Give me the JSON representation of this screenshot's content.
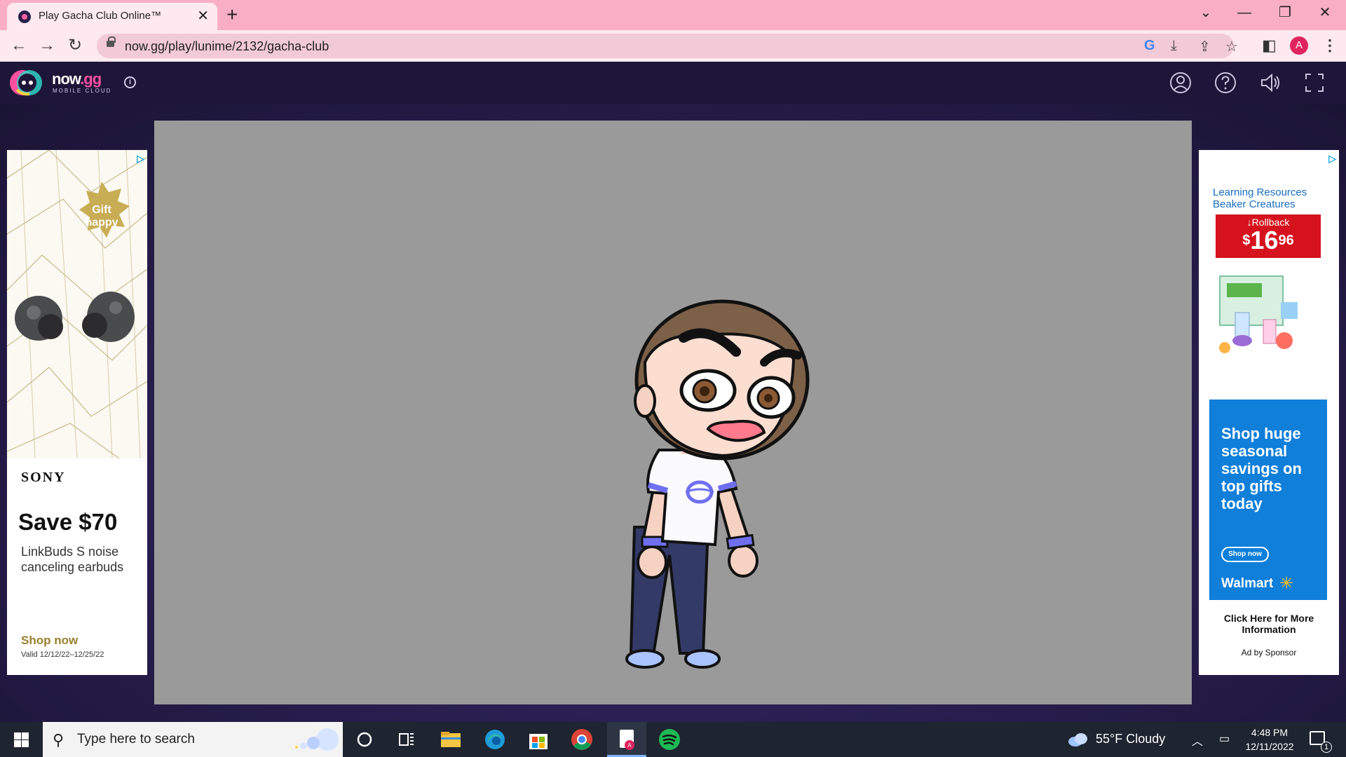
{
  "browser": {
    "tab_title": "Play Gacha Club Online™",
    "tab_close": "✕",
    "new_tab": "+",
    "url": "now.gg/play/lunime/2132/gacha-club",
    "profile_initial": "A",
    "window_controls": {
      "dropdown": "⌄",
      "minimize": "—",
      "restore": "❐",
      "close": "✕"
    }
  },
  "nowgg": {
    "logo_text": "now",
    "logo_gg": ".gg",
    "logo_sub": "MOBILE CLOUD",
    "info": "i"
  },
  "ad_left": {
    "brand": "SONY",
    "badge_line1": "Gift",
    "badge_line2": "happy",
    "headline": "Save $70",
    "description": "LinkBuds S noise canceling earbuds",
    "cta": "Shop now",
    "valid": "Valid 12/12/22–12/25/22"
  },
  "ad_right": {
    "product": "Learning Resources Beaker Creatures",
    "rollback_label": "Rollback",
    "price_dollars": "16",
    "price_cents": "96",
    "price_symbol": "$",
    "message": "Shop huge seasonal savings on top gifts today",
    "cta": "Shop now",
    "retailer": "Walmart",
    "more_info": "Click Here for More Information",
    "sponsor": "Ad by Sponsor"
  },
  "taskbar": {
    "search_placeholder": "Type here to search",
    "weather": "55°F  Cloudy",
    "time": "4:48 PM",
    "date": "12/11/2022",
    "notification_count": "1"
  },
  "colors": {
    "tab_strip": "#f9aec6",
    "nowgg_header": "#1d1638",
    "game_background": "#9a9a9a",
    "walmart_blue": "#0f7fd9",
    "rollback_red": "#d5121d"
  }
}
